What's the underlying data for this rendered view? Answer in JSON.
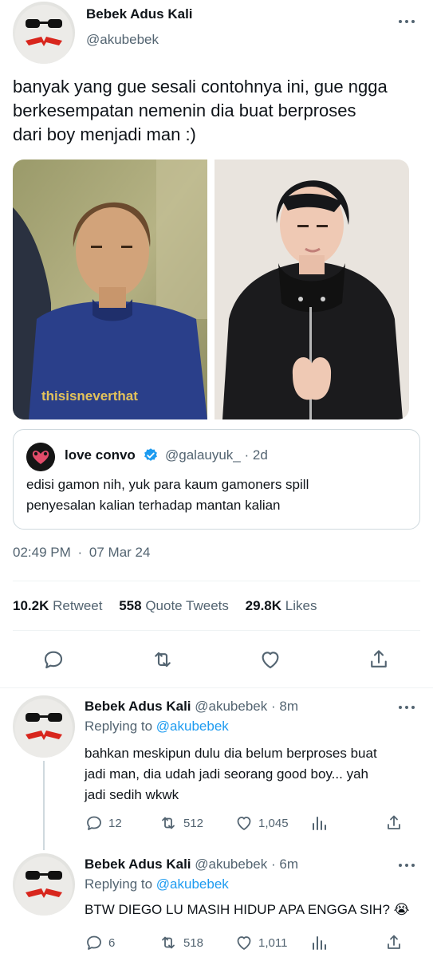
{
  "main_tweet": {
    "display_name": "Bebek Adus Kali",
    "handle": "@akubebek",
    "text_lines": [
      "banyak yang gue sesali contohnya ini, gue ngga",
      "berkesempatan nemenin dia buat berproses",
      "dari boy menjadi man :)"
    ],
    "photo_left_shirt_text": "thisisneverthat",
    "timestamp": "02:49 PM",
    "date": "07 Mar 24",
    "separator": "·"
  },
  "quoted_tweet": {
    "display_name": "love convo",
    "handle": "@galauyuk_",
    "age": "· 2d",
    "text_lines": [
      "edisi gamon nih, yuk para kaum gamoners spill",
      "penyesalan kalian terhadap mantan kalian"
    ]
  },
  "stats": {
    "retweets": {
      "count": "10.2K",
      "label": "Retweet"
    },
    "quotes": {
      "count": "558",
      "label": "Quote Tweets"
    },
    "likes": {
      "count": "29.8K",
      "label": "Likes"
    }
  },
  "replies": [
    {
      "display_name": "Bebek Adus Kali",
      "handle": "@akubebek",
      "age": "· 8m",
      "replying_prefix": "Replying to",
      "replying_to": "@akubebek",
      "text_lines": [
        "bahkan meskipun dulu dia belum berproses buat",
        "jadi man, dia udah jadi seorang good boy... yah",
        "jadi sedih wkwk"
      ],
      "reply_count": "12",
      "retweet_count": "512",
      "like_count": "1,045"
    },
    {
      "display_name": "Bebek Adus Kali",
      "handle": "@akubebek",
      "age": "· 6m",
      "replying_prefix": "Replying to",
      "replying_to": "@akubebek",
      "text_lines": [
        "BTW DIEGO LU MASIH HIDUP APA ENGGA SIH? 😭"
      ],
      "reply_count": "6",
      "retweet_count": "518",
      "like_count": "1,011"
    }
  ],
  "colors": {
    "accent": "#1d9bf0",
    "muted": "#536471",
    "divider": "#eff3f4",
    "verified": "#1d9bf0"
  },
  "icons": [
    "reply-icon",
    "retweet-icon",
    "like-icon",
    "share-icon",
    "views-icon",
    "more-icon",
    "verified-badge-icon"
  ]
}
